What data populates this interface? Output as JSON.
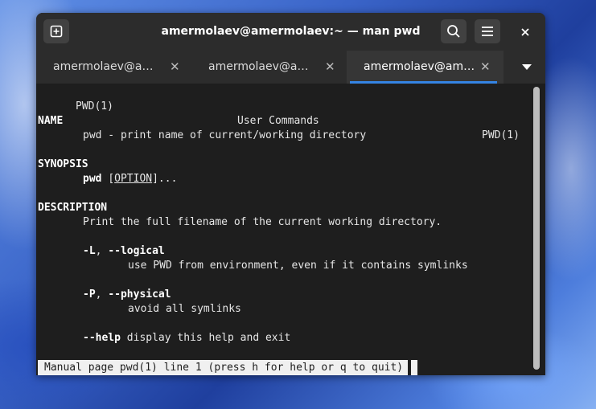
{
  "window": {
    "title": "amermolaev@amermolaev:~ — man pwd",
    "icons": [
      "new-tab-icon",
      "search-icon",
      "hamburger-menu-icon",
      "close-icon",
      "chevron-down-icon"
    ]
  },
  "tabs": [
    {
      "label": "amermolaev@a…",
      "active": false
    },
    {
      "label": "amermolaev@a…",
      "active": false
    },
    {
      "label": "amermolaev@am…",
      "active": true
    }
  ],
  "man": {
    "header_left": "PWD(1)",
    "header_center": "User Commands",
    "header_right": "PWD(1)",
    "name_heading": "NAME",
    "name_text": "pwd - print name of current/working directory",
    "synopsis_heading": "SYNOPSIS",
    "synopsis_cmd": "pwd",
    "synopsis_open": "[",
    "synopsis_option": "OPTION",
    "synopsis_close": "]...",
    "description_heading": "DESCRIPTION",
    "description_text": "Print the full filename of the current working directory.",
    "opt_L_short": "-L",
    "opt_sep": ",",
    "opt_L_long": "--logical",
    "opt_L_desc": "use PWD from environment, even if it contains symlinks",
    "opt_P_short": "-P",
    "opt_P_long": "--physical",
    "opt_P_desc": "avoid all symlinks",
    "opt_help": "--help",
    "opt_help_desc": "display this help and exit"
  },
  "status": "Manual page pwd(1) line 1 (press h for help or q to quit)"
}
